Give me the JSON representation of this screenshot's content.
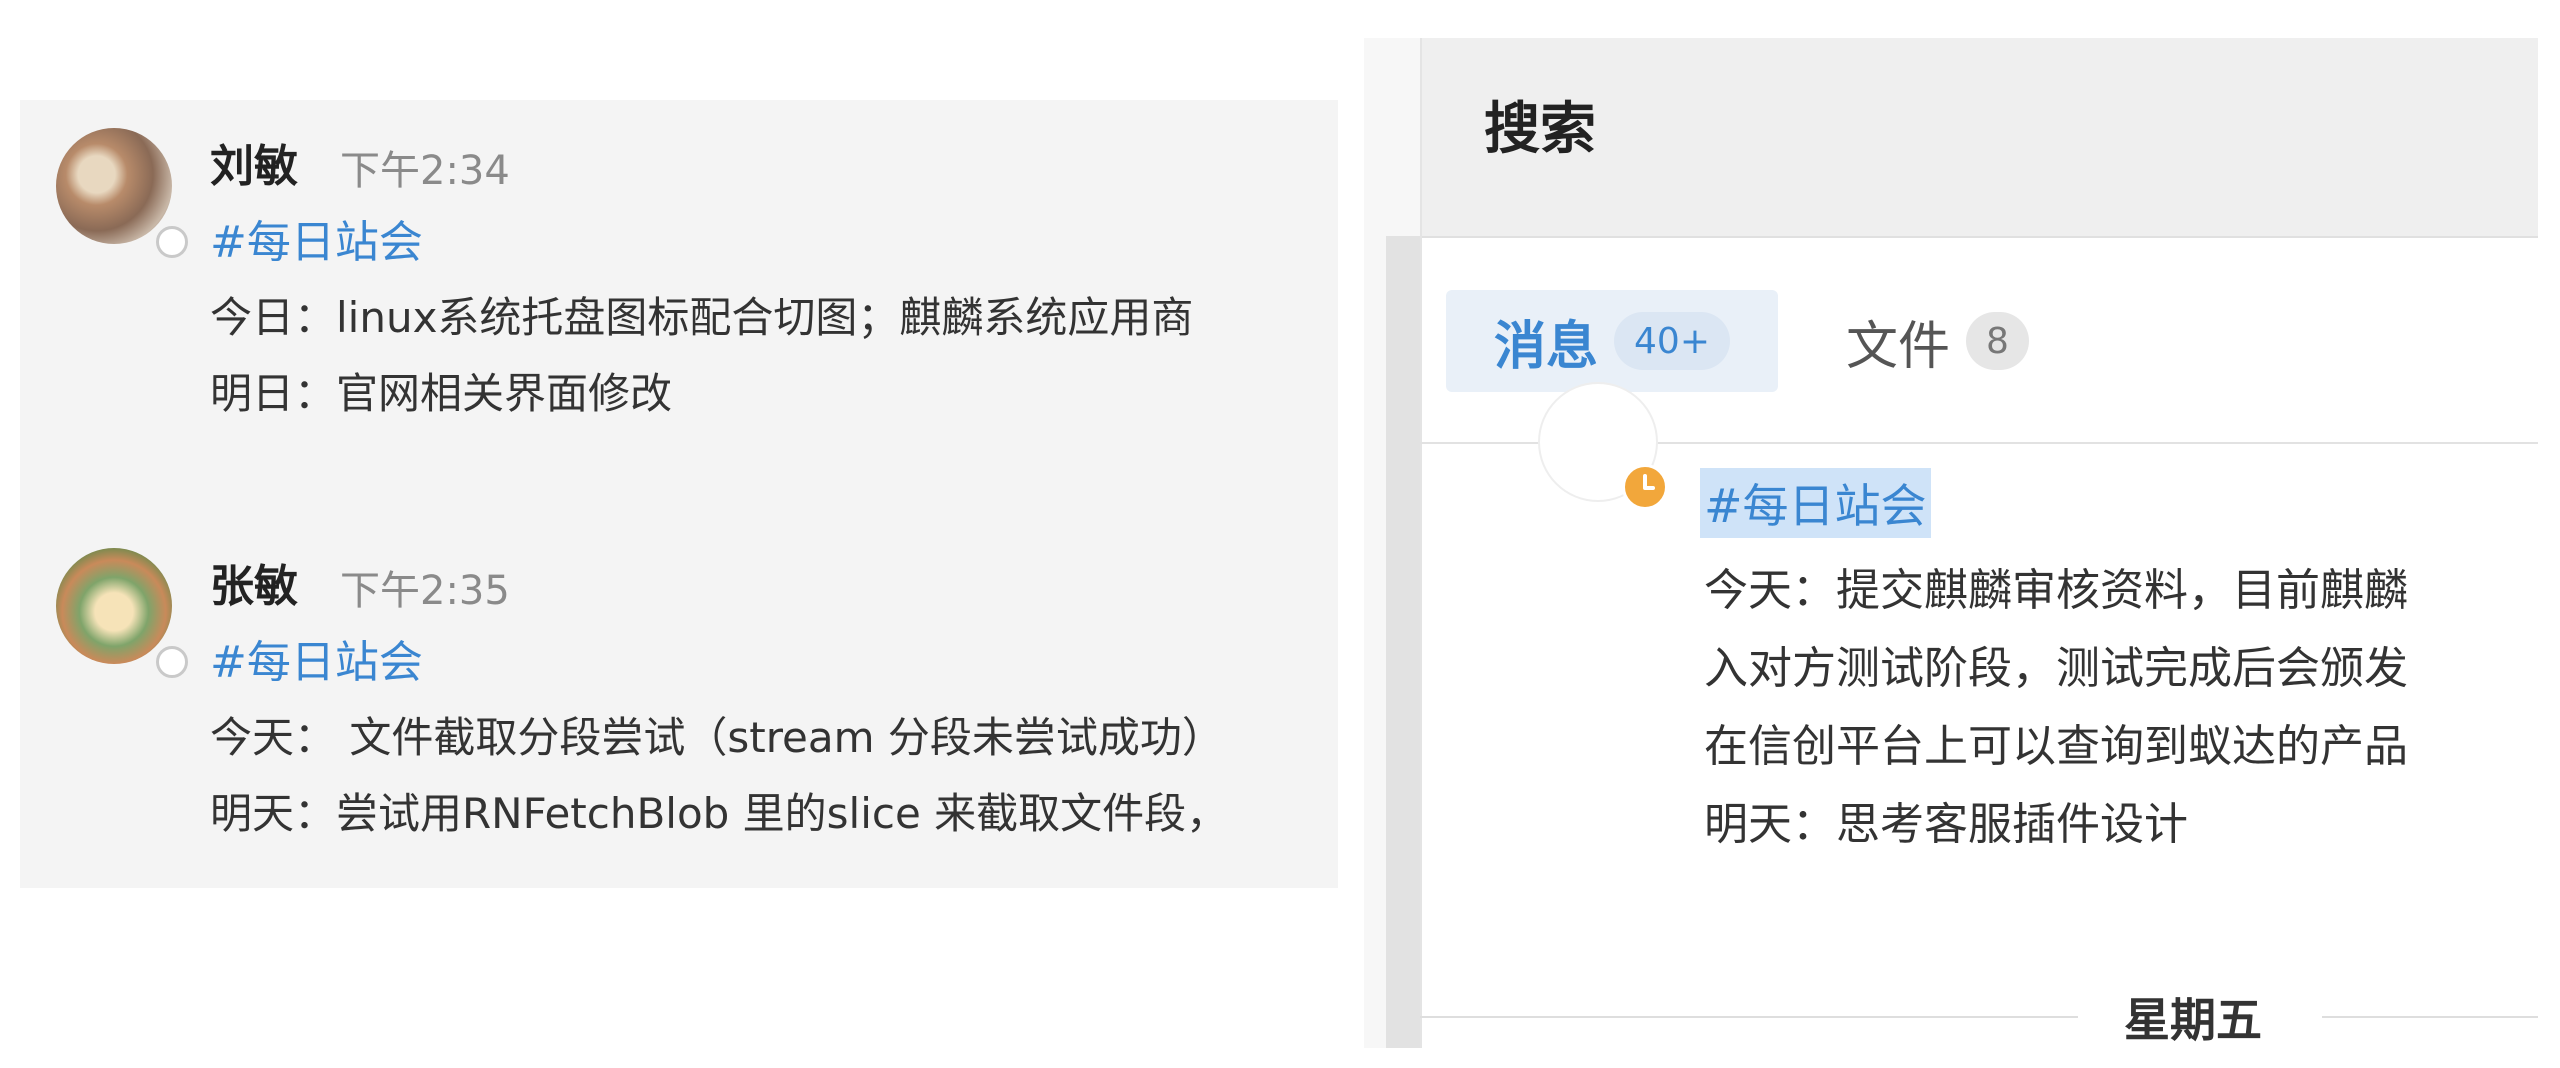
{
  "chat": {
    "messages": [
      {
        "author": "刘敏",
        "time": "下午2:34",
        "channel_tag": "#每日站会",
        "lines": [
          "今日：linux系统托盘图标配合切图；麒麟系统应用商",
          "明日：官网相关界面修改"
        ]
      },
      {
        "author": "张敏",
        "time": "下午2:35",
        "channel_tag": "#每日站会",
        "lines": [
          "今天： 文件截取分段尝试（stream 分段未尝试成功）",
          "明天：尝试用RNFetchBlob 里的slice 来截取文件段，"
        ]
      }
    ]
  },
  "search": {
    "title": "搜索",
    "tabs": [
      {
        "label": "消息",
        "count": "40+",
        "active": true
      },
      {
        "label": "文件",
        "count": "8",
        "active": false
      }
    ],
    "result": {
      "channel_tag": "#每日站会",
      "lines": [
        "今天：提交麒麟审核资料，目前麒麟",
        "入对方测试阶段，测试完成后会颁发",
        "在信创平台上可以查询到蚁达的产品",
        "明天：思考客服插件设计"
      ]
    },
    "day_separator": "星期五"
  },
  "colors": {
    "accent": "#3a86d1",
    "highlight": "#cfe3f8",
    "status_clock": "#f2a73b"
  }
}
